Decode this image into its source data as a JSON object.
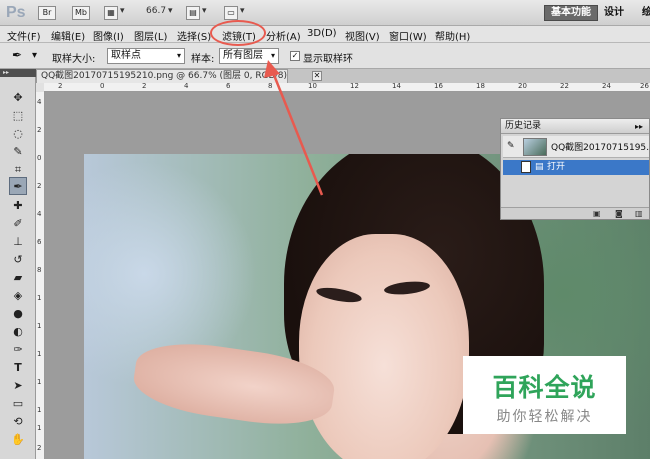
{
  "appbar": {
    "logo": "Ps",
    "br_label": "Br",
    "mb_label": "Mb",
    "zoom_level": "66.7",
    "workspace_active": "基本功能",
    "workspace_design": "设计",
    "workspace_more": "绘"
  },
  "menu": {
    "items": [
      "文件(F)",
      "编辑(E)",
      "图像(I)",
      "图层(L)",
      "选择(S)",
      "滤镜(T)",
      "分析(A)",
      "3D(D)",
      "视图(V)",
      "窗口(W)",
      "帮助(H)"
    ]
  },
  "options": {
    "sample_size_label": "取样大小:",
    "sample_size_value": "取样点",
    "sample_label": "样本:",
    "sample_value": "所有图层",
    "show_ring_label": "显示取样环",
    "show_ring_checked": "✓"
  },
  "document": {
    "tab_title": "QQ截图20170715195210.png @ 66.7% (图层 0, RGB/8) *",
    "close": "✕"
  },
  "rulers": {
    "h_labels": [
      "2",
      "0",
      "2",
      "4",
      "6",
      "8",
      "10",
      "12",
      "14",
      "16",
      "18",
      "20",
      "22",
      "24",
      "26"
    ],
    "v_labels": [
      "4",
      "2",
      "0",
      "2",
      "4",
      "6",
      "8",
      "1",
      "1",
      "1",
      "1",
      "1",
      "1",
      "2"
    ]
  },
  "history": {
    "title": "历史记录",
    "expand": "▸▸",
    "snapshot_name": "QQ截图20170715195…",
    "step_label": "打开"
  },
  "watermark": {
    "title": "百科全说",
    "subtitle": "助你轻松解决"
  },
  "colors": {
    "annotation_red": "#e85a4f",
    "selection_blue": "#3b78c8",
    "watermark_green": "#2fa45a"
  }
}
